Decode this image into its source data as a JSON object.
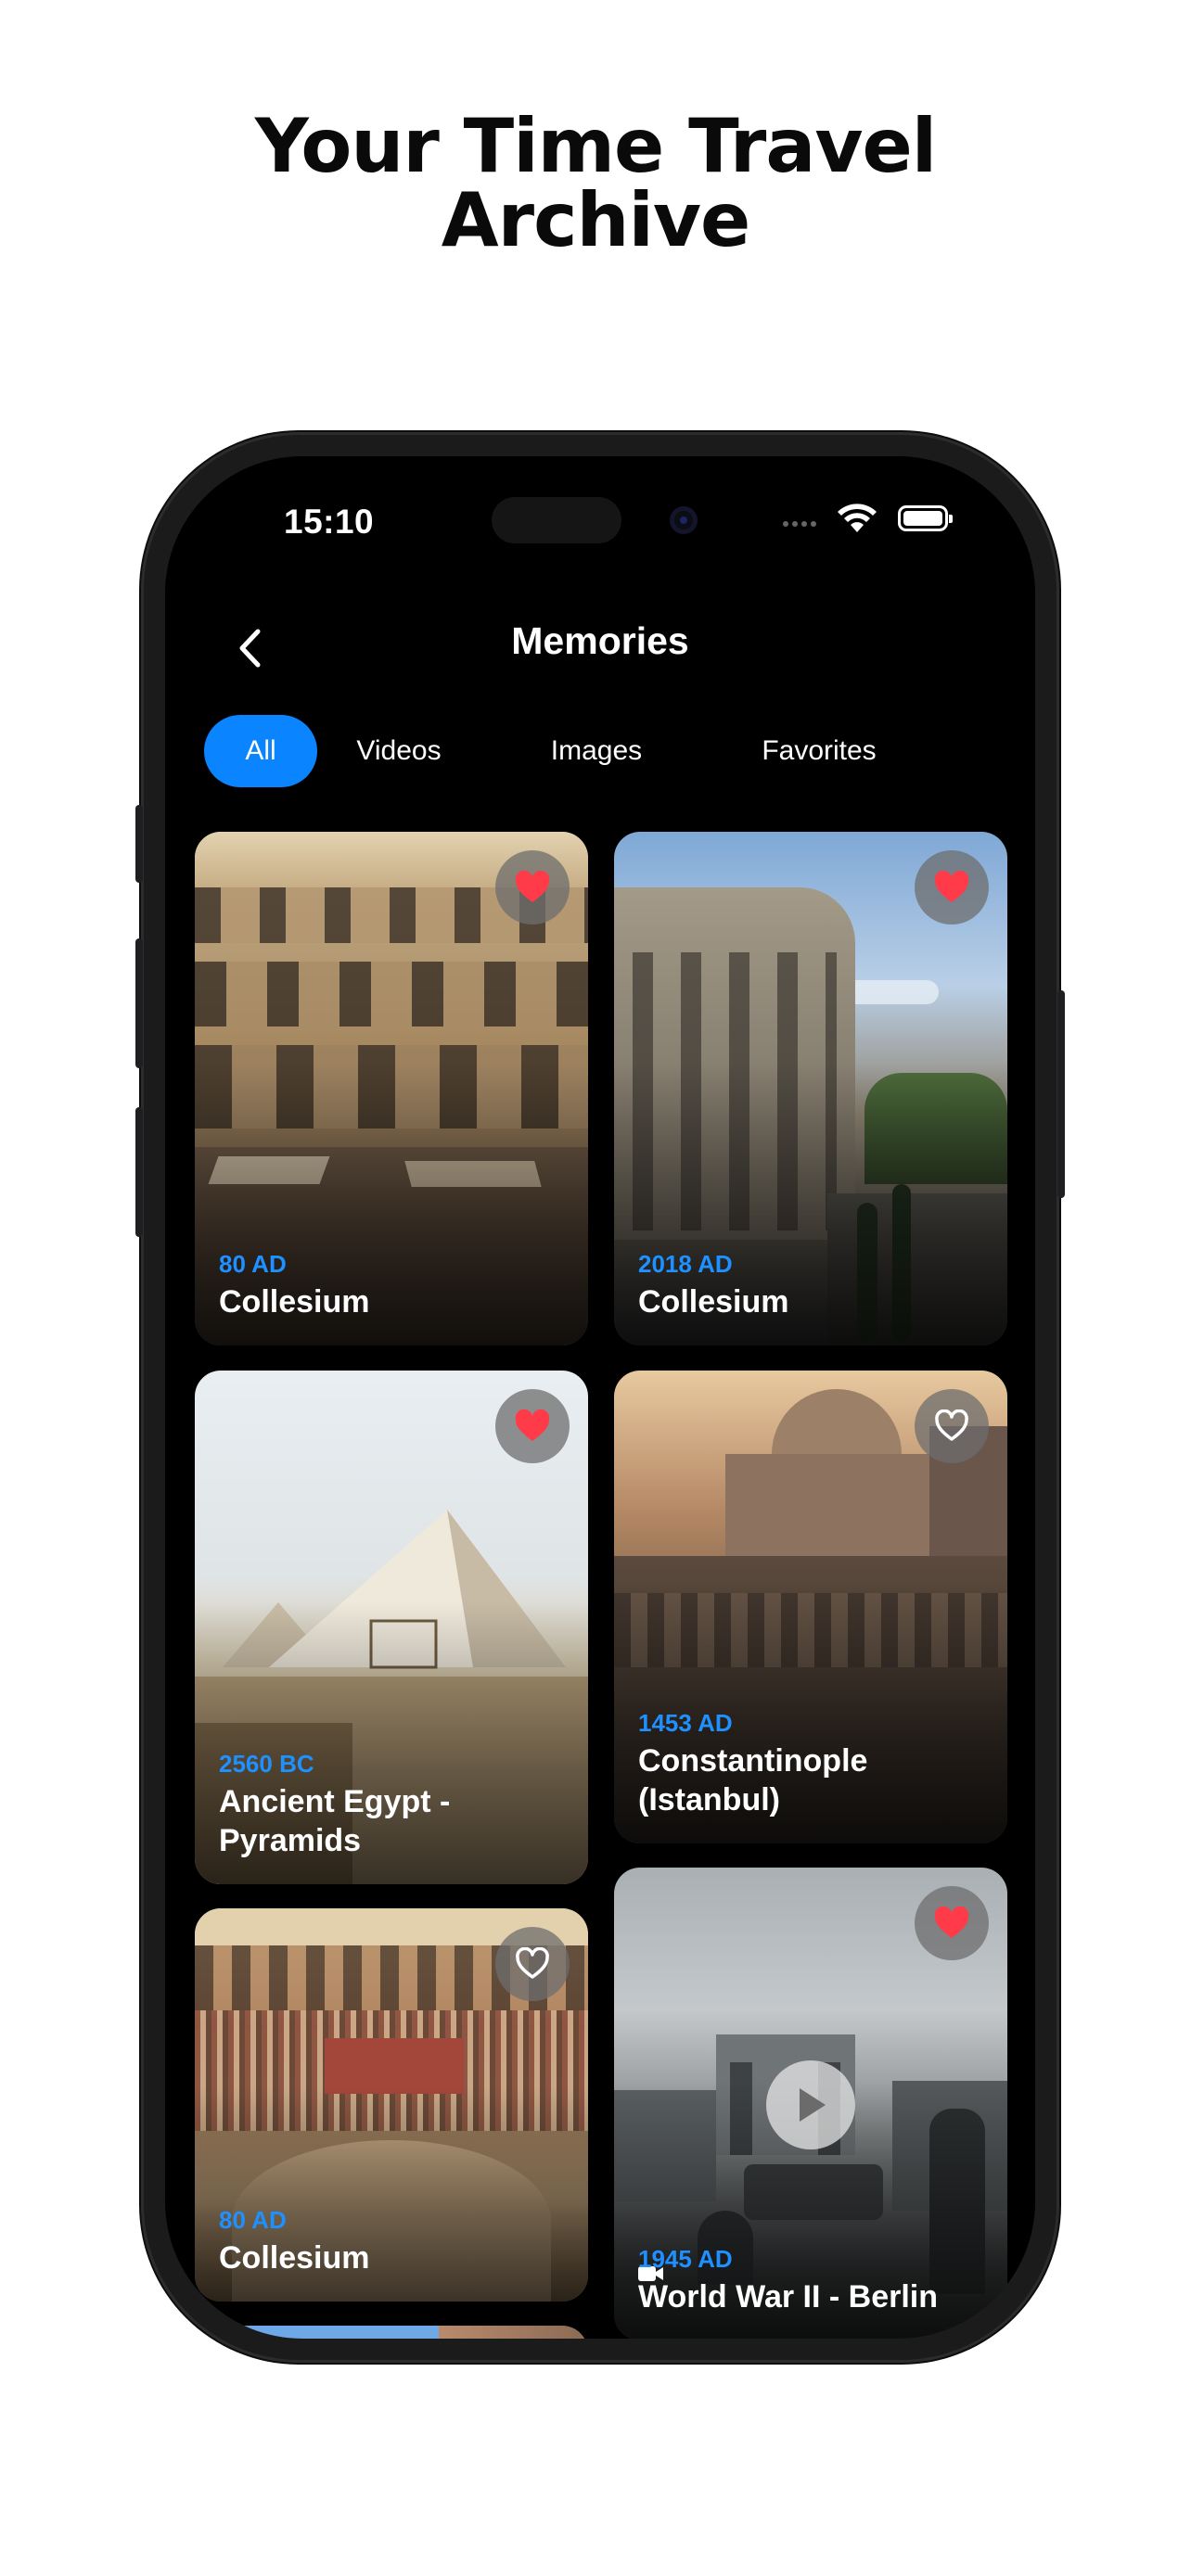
{
  "promo": {
    "headline_line1": "Your Time Travel",
    "headline_line2": "Archive"
  },
  "status_bar": {
    "time": "15:10",
    "icons": [
      "wifi-icon",
      "battery-icon"
    ]
  },
  "nav": {
    "title": "Memories",
    "back_icon": "chevron-left-icon"
  },
  "filters": {
    "tabs": [
      {
        "label": "All",
        "active": true
      },
      {
        "label": "Videos",
        "active": false
      },
      {
        "label": "Images",
        "active": false
      },
      {
        "label": "Favorites",
        "active": false
      }
    ]
  },
  "memories": [
    {
      "year": "80 AD",
      "title": "Collesium",
      "favorite": true,
      "media": "image"
    },
    {
      "year": "2018 AD",
      "title": "Collesium",
      "favorite": true,
      "media": "image"
    },
    {
      "year": "2560 BC",
      "title": "Ancient Egypt - Pyramids",
      "favorite": true,
      "media": "image"
    },
    {
      "year": "1453 AD",
      "title": "Constantinople (Istanbul)",
      "favorite": false,
      "media": "image"
    },
    {
      "year": "80 AD",
      "title": "Collesium",
      "favorite": false,
      "media": "image"
    },
    {
      "year": "1945 AD",
      "title": "World War II - Berlin",
      "favorite": true,
      "media": "video"
    }
  ],
  "colors": {
    "accent": "#0a84ff",
    "year_text": "#1e90ff",
    "heart_filled": "#ff3b4a",
    "screen_bg": "#000000"
  }
}
